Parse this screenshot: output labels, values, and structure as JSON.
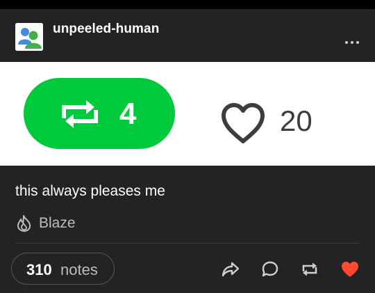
{
  "header": {
    "blog_name": "unpeeled-human",
    "avatar_icon": "users-icon",
    "more_icon": "ellipsis-icon"
  },
  "content_image": {
    "reblog_count": "4",
    "reblog_icon": "reblog-icon",
    "like_count": "20",
    "like_icon": "heart-outline-icon",
    "reblog_pill_color": "#00c93b"
  },
  "caption": "this always pleases me",
  "blaze": {
    "label": "Blaze",
    "icon": "flame-icon"
  },
  "footer": {
    "notes_count": "310",
    "notes_label": "notes",
    "actions": [
      "share-icon",
      "reply-icon",
      "reblog-icon",
      "like-icon"
    ],
    "like_color": "#ff4930"
  }
}
